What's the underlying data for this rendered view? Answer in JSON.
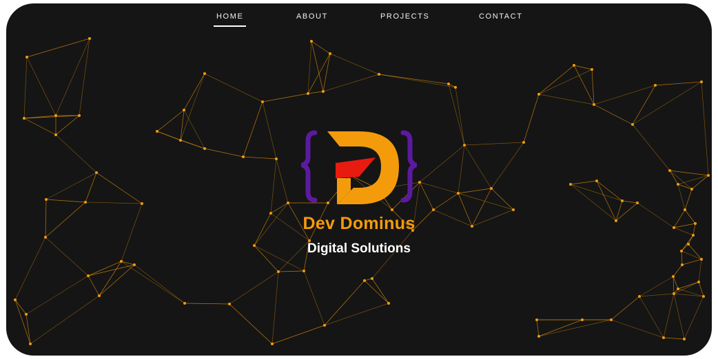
{
  "nav": {
    "items": [
      {
        "label": "HOME",
        "active": true
      },
      {
        "label": "ABOUT",
        "active": false
      },
      {
        "label": "PROJECTS",
        "active": false
      },
      {
        "label": "CONTACT",
        "active": false
      }
    ]
  },
  "hero": {
    "brand_name": "Dev Dominus",
    "tagline": "Digital Solutions",
    "logo_icon": "dev-dominus-brace-d-logo"
  },
  "colors": {
    "background": "#151515",
    "accent_orange": "#f49b0c",
    "logo_purple": "#5b1aa0",
    "logo_red": "#e81b10",
    "text_white": "#ffffff"
  }
}
